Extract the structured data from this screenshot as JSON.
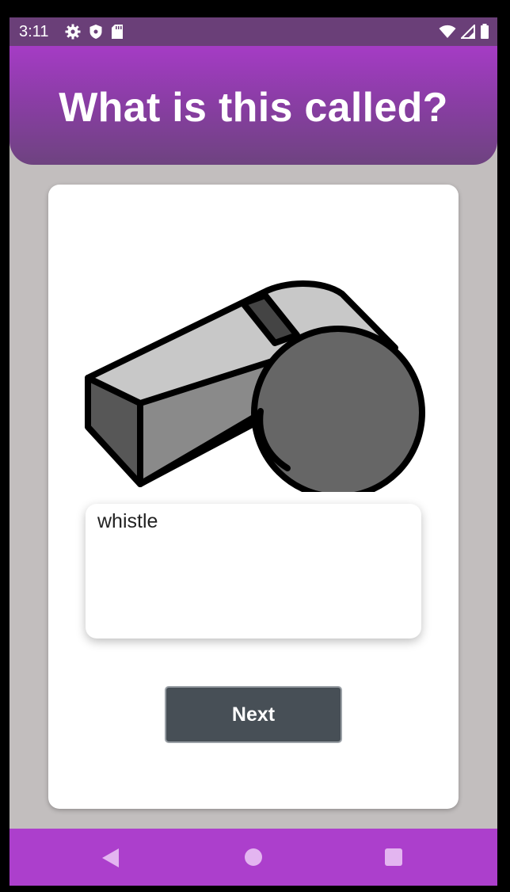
{
  "status_bar": {
    "time": "3:11",
    "left_icons": [
      "gear-icon",
      "shield-icon",
      "sd-card-icon"
    ],
    "right_icons": [
      "wifi-icon",
      "cell-signal-icon",
      "battery-icon"
    ]
  },
  "header": {
    "title": "What is this called?"
  },
  "card": {
    "image_subject": "whistle-icon",
    "answer_value": "whistle",
    "next_label": "Next"
  },
  "nav_bar": {
    "items": [
      "back-icon",
      "home-icon",
      "recents-icon"
    ]
  },
  "colors": {
    "status_bar": "#6a3f78",
    "header_top": "#a53cc5",
    "header_bottom": "#6e4380",
    "background": "#c2bebe",
    "button": "#474f56",
    "nav_bar": "#ac3fcc",
    "nav_icons": "#e3b5f0"
  }
}
